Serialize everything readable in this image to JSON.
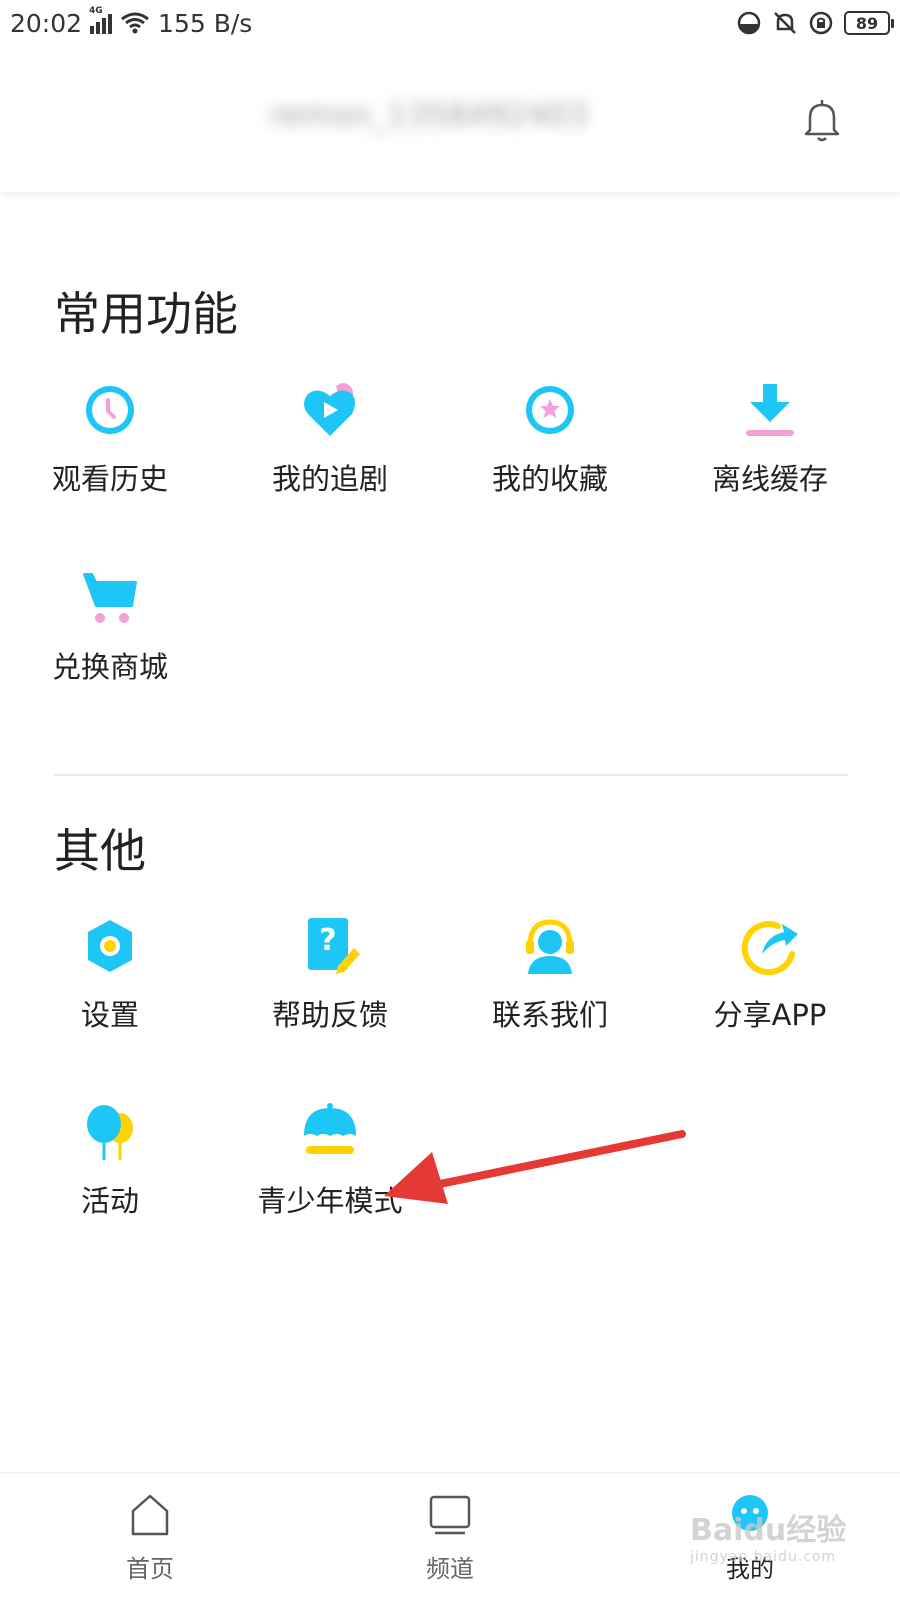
{
  "status_bar": {
    "time": "20:02",
    "network_type": "4G",
    "speed": "155 B/s",
    "battery": "89"
  },
  "header": {
    "username": "remon_1358492403"
  },
  "sections": [
    {
      "title": "常用功能",
      "items": [
        {
          "label": "观看历史",
          "icon": "clock-icon"
        },
        {
          "label": "我的追剧",
          "icon": "heart-play-icon"
        },
        {
          "label": "我的收藏",
          "icon": "star-icon"
        },
        {
          "label": "离线缓存",
          "icon": "download-icon"
        },
        {
          "label": "兑换商城",
          "icon": "cart-icon"
        }
      ]
    },
    {
      "title": "其他",
      "items": [
        {
          "label": "设置",
          "icon": "hexagon-settings-icon"
        },
        {
          "label": "帮助反馈",
          "icon": "help-doc-icon"
        },
        {
          "label": "联系我们",
          "icon": "headset-icon"
        },
        {
          "label": "分享APP",
          "icon": "share-arrow-icon"
        },
        {
          "label": "活动",
          "icon": "balloon-icon"
        },
        {
          "label": "青少年模式",
          "icon": "umbrella-icon"
        }
      ]
    }
  ],
  "bottom_nav": [
    {
      "label": "首页",
      "icon": "home-icon",
      "active": false
    },
    {
      "label": "频道",
      "icon": "tv-icon",
      "active": false
    },
    {
      "label": "我的",
      "icon": "profile-icon",
      "active": true
    }
  ],
  "watermark": {
    "text": "Baidu经验",
    "sub": "jingyan.baidu.com"
  },
  "colors": {
    "accent_blue": "#1ec6f5",
    "pink": "#f59fd6",
    "yellow": "#ffd200",
    "annotation_red": "#e53935"
  }
}
